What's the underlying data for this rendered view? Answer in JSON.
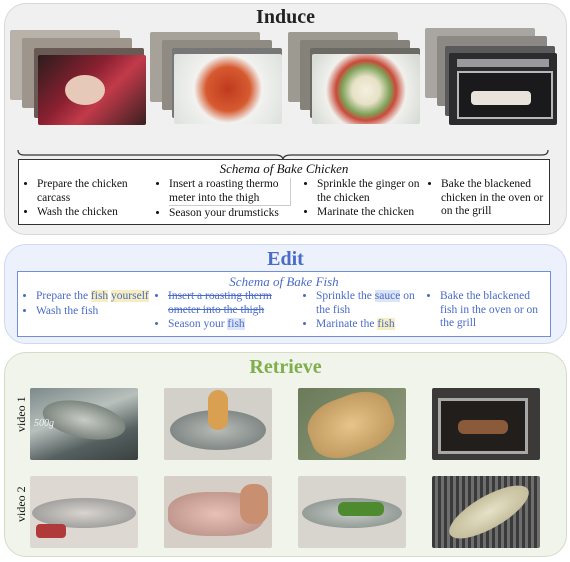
{
  "induce": {
    "title": "Induce",
    "schema_title": "Schema of Bake Chicken",
    "columns": [
      [
        "Prepare the chicken carcass",
        "Wash the chicken"
      ],
      [
        "Insert a roasting thermo meter into the thigh",
        "Season your drumsticks"
      ],
      [
        "Sprinkle the ginger on the chicken",
        "Marinate the chicken"
      ],
      [
        "Bake the blackened chicken in the oven or on the grill"
      ]
    ]
  },
  "edit": {
    "title": "Edit",
    "schema_title": "Schema of Bake Fish",
    "col1": {
      "a_pre": "Prepare the ",
      "a_word": "fish",
      "a_word2": "yourself",
      "b_pre": "Wash the fish"
    },
    "col2": {
      "a_strike": "Insert a roasting therm ometer into the thigh",
      "b_pre": "Season your ",
      "b_word": "fish"
    },
    "col3": {
      "a_pre": "Sprinkle the ",
      "a_word": "sauce",
      "a_post": "on the fish",
      "b_pre": "Marinate the ",
      "b_word": "fish"
    },
    "col4": {
      "a": "Bake the blackened fish in the oven or on the grill"
    }
  },
  "retrieve": {
    "title": "Retrieve",
    "video1_label": "video 1",
    "video2_label": "video 2",
    "overlay_text": "500g"
  },
  "colors": {
    "edit_accent": "#4a6bc7",
    "retrieve_accent": "#7fae4c"
  }
}
